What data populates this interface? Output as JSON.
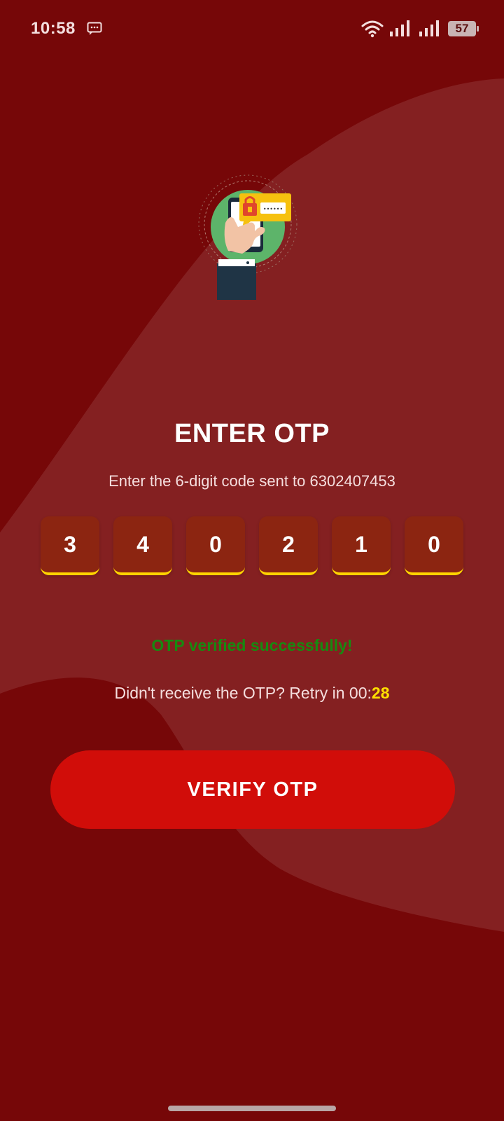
{
  "status_bar": {
    "time": "10:58",
    "battery_level": "57",
    "icons": [
      "message-icon",
      "wifi-icon",
      "signal-icon",
      "signal-icon",
      "battery-icon"
    ]
  },
  "illustration": {
    "icon": "phone-otp-lock-illustration"
  },
  "otp_screen": {
    "title": "ENTER OTP",
    "subtitle": "Enter the 6-digit code sent to 6302407453",
    "digits": [
      "3",
      "4",
      "0",
      "2",
      "1",
      "0"
    ],
    "success_message": "OTP verified successfully!",
    "retry_prefix": "Didn't receive the OTP? Retry in 00:",
    "retry_seconds": "28"
  },
  "actions": {
    "verify_label": "VERIFY OTP"
  },
  "colors": {
    "background": "#760708",
    "accent_yellow": "#ffd400",
    "button": "#d10d09",
    "success": "#178a10",
    "otp_box": "#8c2511"
  }
}
